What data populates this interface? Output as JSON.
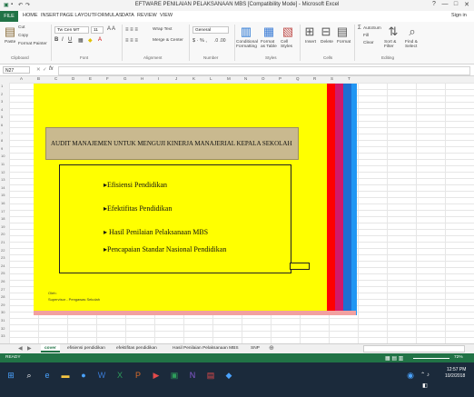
{
  "window": {
    "title": "EFTWARE PENILAIAN PELAKSANAAN MBS [Compatibility Mode] - Microsoft Excel",
    "controls": [
      "?",
      "—",
      "□",
      "✕"
    ],
    "sign_in": "Sign in"
  },
  "ribbon_tabs": [
    "FILE",
    "HOME",
    "INSERT",
    "PAGE LAYOUT",
    "FORMULAS",
    "DATA",
    "REVIEW",
    "VIEW"
  ],
  "ribbon": {
    "clipboard": {
      "cut": "Cut",
      "copy": "Copy",
      "paste": "Paste",
      "format_painter": "Format Painter",
      "label": "Clipboard"
    },
    "font": {
      "name": "Tw Cen MT",
      "size": "11",
      "label": "Font"
    },
    "alignment": {
      "wrap": "Wrap Text",
      "merge": "Merge & Center",
      "label": "Alignment"
    },
    "number": {
      "format": "General",
      "label": "Number"
    },
    "styles": {
      "conditional": "Conditional Formatting",
      "table": "Format as Table",
      "cell": "Cell Styles",
      "label": "Styles"
    },
    "cells": {
      "insert": "Insert",
      "delete": "Delete",
      "format": "Format",
      "label": "Cells"
    },
    "editing": {
      "autosum": "AutoSum",
      "fill": "Fill",
      "clear": "Clear",
      "sort": "Sort & Filter",
      "find": "Find & Select",
      "label": "Editing"
    }
  },
  "formula_bar": {
    "name_box": "N27",
    "fx": "fx"
  },
  "columns": [
    "A",
    "B",
    "C",
    "D",
    "E",
    "F",
    "G",
    "H",
    "I",
    "J",
    "K",
    "L",
    "M",
    "N",
    "O",
    "P",
    "Q",
    "R",
    "S",
    "T"
  ],
  "rows": [
    "1",
    "2",
    "3",
    "4",
    "5",
    "6",
    "7",
    "8",
    "9",
    "10",
    "11",
    "12",
    "13",
    "14",
    "15",
    "16",
    "17",
    "18",
    "19",
    "20",
    "21",
    "22",
    "23",
    "24",
    "25",
    "26",
    "27",
    "28",
    "29",
    "30",
    "31",
    "32",
    "33"
  ],
  "slide": {
    "banner": "AUDIT MANAJEMEN UNTUK MENGUJI KINERJA MANAJERIAL KEPALA SEKOLAH",
    "bullets": [
      "Efisiensi Pendidikan",
      "Efektifitas Pendidikan",
      "Hasil Penilaian Pelaksanaan MBS",
      "Pencapaian Standar Nasional Pendidikan"
    ],
    "footnote_1": "Oleh:",
    "footnote_2": "Supervisor - Pengawas Sekolah",
    "stripe_colors": [
      "#ff0000",
      "#d11a6a",
      "#1e6fd1",
      "#2196f3"
    ]
  },
  "sheet_tabs": [
    "cover",
    "efisiensi pendidikan",
    "efektifitas pendidikan",
    "Hasil Penilaian Pelaksanaan MBS",
    "SNP"
  ],
  "status": {
    "ready": "READY",
    "zoom": "72%"
  },
  "taskbar": {
    "time": "12:57 PM",
    "date": "10/2/2018"
  },
  "colors": {
    "excel_green": "#217346",
    "slide_yellow": "#ffff00",
    "banner_tan": "#c9b98f"
  }
}
